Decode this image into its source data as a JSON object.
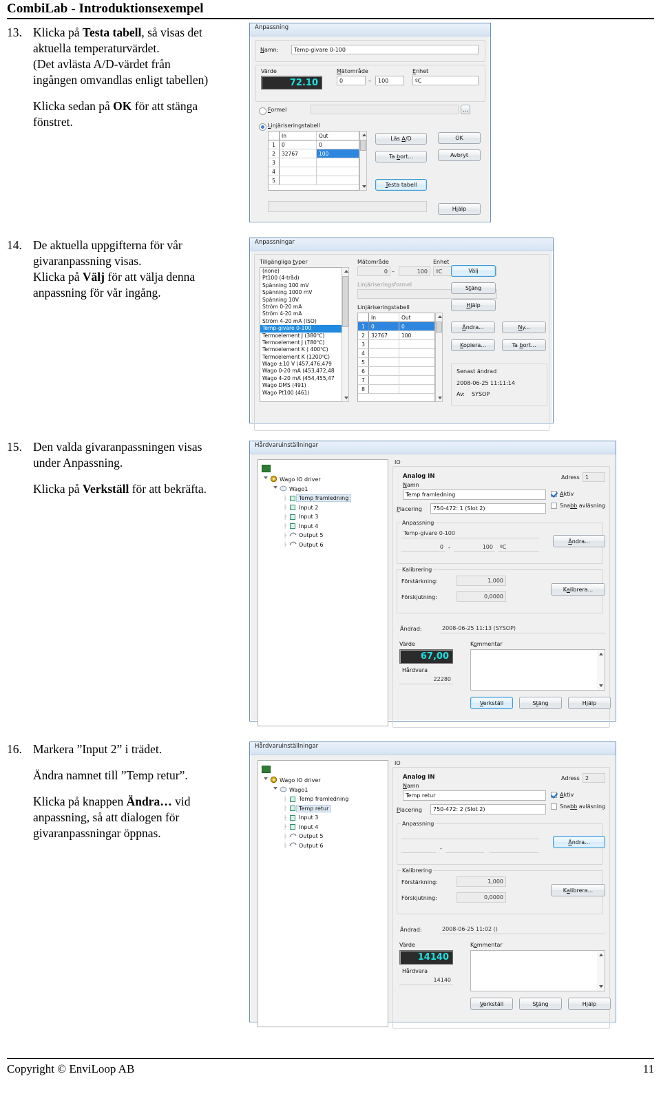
{
  "header": {
    "title": "CombiLab - Introduktionsexempel"
  },
  "footer": {
    "copyright": "Copyright © EnviLoop AB",
    "page": "11"
  },
  "steps": [
    {
      "num": "13.",
      "lines": [
        "Klicka på |Testa tabell|, så visas det aktuella temperaturvärdet.",
        "(Det avlästa A/D-värdet från ingången omvandlas enligt tabellen)",
        "",
        "Klicka sedan på |OK| för att stänga fönstret."
      ]
    },
    {
      "num": "14.",
      "lines": [
        "De aktuella uppgifterna för vår givaranpassning visas.",
        "Klicka på |Välj| för att välja denna anpassning för vår ingång."
      ]
    },
    {
      "num": "15.",
      "lines": [
        "Den valda givaranpassningen visas under Anpassning.",
        "",
        "Klicka på |Verkställ| för att bekräfta."
      ]
    },
    {
      "num": "16.",
      "lines": [
        "Markera ”Input 2” i trädet.",
        "",
        "Ändra namnet till ”Temp retur”.",
        "",
        "Klicka på knappen |Ändra…| vid anpassning, så att dialogen för givaranpassningar öppnas."
      ]
    }
  ],
  "dialog_anpassning": {
    "title": "Anpassning",
    "name_label": "Namn:",
    "name_value": "Temp-givare 0-100",
    "varde_label": "Värde",
    "varde_value": "72.10",
    "matomrade_label": "Mätområde",
    "matomrade_min": "0",
    "matomrade_dash": "–",
    "matomrade_max": "100",
    "enhet_label": "Enhet",
    "enhet_value": "ºC",
    "formel_label": "Formel",
    "formel_value": "",
    "formel_selected": false,
    "table_label": "Linjäriseringstabell",
    "table_selected": true,
    "table_headers": [
      "",
      "In",
      "Out"
    ],
    "table_rows": [
      {
        "idx": "1",
        "in": "0",
        "out": "0",
        "sel": "none"
      },
      {
        "idx": "2",
        "in": "32767",
        "out": "100",
        "sel": "out"
      },
      {
        "idx": "3",
        "in": "",
        "out": "",
        "sel": "none"
      },
      {
        "idx": "4",
        "in": "",
        "out": "",
        "sel": "none"
      },
      {
        "idx": "5",
        "in": "",
        "out": "",
        "sel": "none"
      }
    ],
    "btn_las_ad": "Läs A/D",
    "btn_ta_bort": "Ta bort...",
    "btn_testa_tabell": "Testa tabell",
    "btn_ok": "OK",
    "btn_avbryt": "Avbryt",
    "btn_hjalp": "Hjälp",
    "status": ""
  },
  "dialog_anpassningar": {
    "title": "Anpassningar",
    "types_label": "Tillgängliga typer",
    "types": [
      "(none)",
      "Pt100 (4-tråd)",
      "Spänning 100 mV",
      "Spänning 1000 mV",
      "Spänning 10V",
      "Ström 0-20 mA",
      "Ström 4-20 mA",
      "Ström 4-20 mA (ISO)",
      "Temp-givare 0-100",
      "Termoelement J (380℃)",
      "Termoelement J (780℃)",
      "Termoelement K ( 400℃)",
      "Termoelement K (1200℃)",
      "Wago ±10 V (457,476,479",
      "Wago 0-20 mA (453,472,48",
      "Wago 4-20 mA (454,455,47",
      "Wago DMS (491)",
      "Wago Pt100 (461)"
    ],
    "selected_type": "Temp-givare 0-100",
    "matomrade_label": "Mätområde",
    "matomrade_min": "0",
    "matomrade_dash": "–",
    "matomrade_max": "100",
    "enhet_label": "Enhet",
    "enhet_value": "ºC",
    "formel_label": "Linjäriseringsformel",
    "formel_value": "",
    "table_label": "Linjäriseringstabell",
    "table_headers": [
      "",
      "In",
      "Out"
    ],
    "table_rows": [
      {
        "idx": "1",
        "in": "0",
        "out": "0",
        "sel": "row"
      },
      {
        "idx": "2",
        "in": "32767",
        "out": "100",
        "sel": "none"
      },
      {
        "idx": "3",
        "in": "",
        "out": "",
        "sel": "none"
      },
      {
        "idx": "4",
        "in": "",
        "out": "",
        "sel": "none"
      },
      {
        "idx": "5",
        "in": "",
        "out": "",
        "sel": "none"
      },
      {
        "idx": "6",
        "in": "",
        "out": "",
        "sel": "none"
      },
      {
        "idx": "7",
        "in": "",
        "out": "",
        "sel": "none"
      },
      {
        "idx": "8",
        "in": "",
        "out": "",
        "sel": "none"
      }
    ],
    "btn_valj": "Välj",
    "btn_stang": "Stäng",
    "btn_hjalp": "Hjälp",
    "btn_andra": "Ändra...",
    "btn_ny": "Ny...",
    "btn_kopiera": "Kopiera...",
    "btn_ta_bort": "Ta bort...",
    "senast_label": "Senast ändrad",
    "senast_date": "2008-06-25 11:11:14",
    "av_label": "Av:",
    "av_value": "SYSOP"
  },
  "dialog_hw_1": {
    "title": "Hårdvaruinställningar",
    "io_label": "IO",
    "tree": [
      {
        "label": "Wago IO driver",
        "depth": 0,
        "icon": "gear-icon",
        "sel": false
      },
      {
        "label": "Wago1",
        "depth": 1,
        "icon": "node-icon",
        "sel": false
      },
      {
        "label": "Temp framledning",
        "depth": 2,
        "icon": "analog-in-icon",
        "sel": true
      },
      {
        "label": "Input 2",
        "depth": 2,
        "icon": "analog-in-icon",
        "sel": false
      },
      {
        "label": "Input 3",
        "depth": 2,
        "icon": "analog-in-icon",
        "sel": false
      },
      {
        "label": "Input 4",
        "depth": 2,
        "icon": "analog-in-icon",
        "sel": false
      },
      {
        "label": "Output 5",
        "depth": 2,
        "icon": "output-icon",
        "sel": false
      },
      {
        "label": "Output 6",
        "depth": 2,
        "icon": "output-icon",
        "sel": false
      }
    ],
    "analog_in": "Analog IN",
    "adress_label": "Adress",
    "adress_value": "1",
    "namn_label": "Namn",
    "namn_value": "Temp framledning",
    "aktiv_label": "Aktiv",
    "aktiv_checked": true,
    "snabb_label": "Snabb avläsning",
    "snabb_checked": false,
    "placering_label": "Placering",
    "placering_value": "750-472: 1 (Slot 2)",
    "anpassning_label": "Anpassning",
    "anpassning_value": "Temp-givare 0-100",
    "anpassning_min": "0",
    "anpassning_dash": "-",
    "anpassning_max": "100",
    "anpassning_unit": "ºC",
    "btn_andra": "Ändra...",
    "kalibrering_label": "Kalibrering",
    "forstarkning_label": "Förstärkning:",
    "forstarkning_value": "1,000",
    "forskjutning_label": "Förskjutning:",
    "forskjutning_value": "0,0000",
    "btn_kalibrera": "Kalibrera...",
    "andrad_label": "Ändrad:",
    "andrad_value": "2008-06-25 11:13  (SYSOP)",
    "varde_label": "Värde",
    "varde_value": "67,00",
    "hardvara_label": "Hårdvara",
    "hardvara_value": "22280",
    "kommentar_label": "Kommentar",
    "kommentar_value": "",
    "btn_verkstall": "Verkställ",
    "btn_stang": "Stäng",
    "btn_hjalp": "Hjälp",
    "default_button": "Verkställ"
  },
  "dialog_hw_2": {
    "title": "Hårdvaruinställningar",
    "io_label": "IO",
    "tree": [
      {
        "label": "Wago IO driver",
        "depth": 0,
        "icon": "gear-icon",
        "sel": false
      },
      {
        "label": "Wago1",
        "depth": 1,
        "icon": "node-icon",
        "sel": false
      },
      {
        "label": "Temp framledning",
        "depth": 2,
        "icon": "analog-in-icon",
        "sel": false
      },
      {
        "label": "Temp retur",
        "depth": 2,
        "icon": "analog-in-icon",
        "sel": true
      },
      {
        "label": "Input 3",
        "depth": 2,
        "icon": "analog-in-icon",
        "sel": false
      },
      {
        "label": "Input 4",
        "depth": 2,
        "icon": "analog-in-icon",
        "sel": false
      },
      {
        "label": "Output 5",
        "depth": 2,
        "icon": "output-icon",
        "sel": false
      },
      {
        "label": "Output 6",
        "depth": 2,
        "icon": "output-icon",
        "sel": false
      }
    ],
    "analog_in": "Analog IN",
    "adress_label": "Adress",
    "adress_value": "2",
    "namn_label": "Namn",
    "namn_value": "Temp retur",
    "aktiv_label": "Aktiv",
    "aktiv_checked": true,
    "snabb_label": "Snabb avläsning",
    "snabb_checked": false,
    "placering_label": "Placering",
    "placering_value": "750-472: 2 (Slot 2)",
    "anpassning_label": "Anpassning",
    "anpassning_value": "",
    "anpassning_min": "",
    "anpassning_dash": "-",
    "anpassning_max": "",
    "anpassning_unit": "",
    "btn_andra": "Ändra...",
    "kalibrering_label": "Kalibrering",
    "forstarkning_label": "Förstärkning:",
    "forstarkning_value": "1,000",
    "forskjutning_label": "Förskjutning:",
    "forskjutning_value": "0,0000",
    "btn_kalibrera": "Kalibrera...",
    "andrad_label": "Ändrad:",
    "andrad_value": "2008-06-25 11:02  ()",
    "varde_label": "Värde",
    "varde_value": "14140",
    "hardvara_label": "Hårdvara",
    "hardvara_value": "14140",
    "kommentar_label": "Kommentar",
    "kommentar_value": "",
    "btn_verkstall": "Verkställ",
    "btn_stang": "Stäng",
    "btn_hjalp": "Hjälp",
    "default_button": "Ändra..."
  },
  "colors": {
    "value_text": "#1fe0e0",
    "value_bg": "#2b2b2b",
    "selection": "#2f86de",
    "default_button_border": "#3c9ad6"
  }
}
